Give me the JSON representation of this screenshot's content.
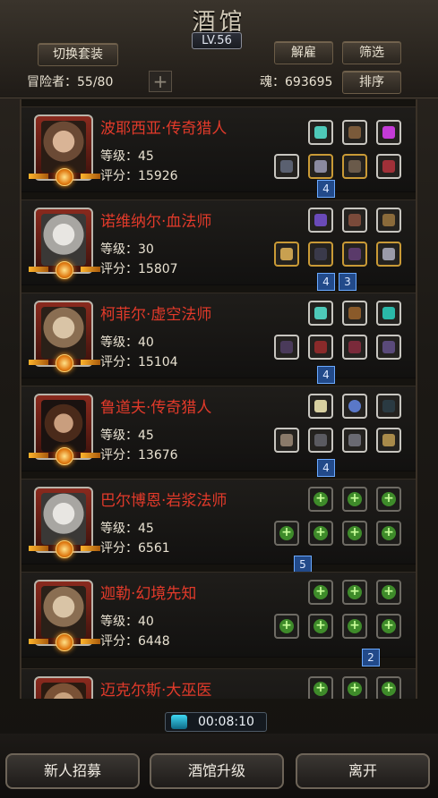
{
  "header": {
    "title": "酒馆",
    "level": "LV.56"
  },
  "toolbar": {
    "switch_outfit": "切换套装",
    "dismiss": "解雇",
    "filter": "筛选",
    "sort": "排序"
  },
  "status": {
    "adventurers": "冒险者：55/80",
    "soul": "魂：693695"
  },
  "heroes": [
    {
      "name": "波耶西亚·传奇猎人",
      "level": "等级：45",
      "score": "评分：15926",
      "badges": [
        "4"
      ]
    },
    {
      "name": "诺维纳尔·血法师",
      "level": "等级：30",
      "score": "评分：15807",
      "badges": [
        "4",
        "3"
      ]
    },
    {
      "name": "柯菲尔·虚空法师",
      "level": "等级：40",
      "score": "评分：15104",
      "badges": [
        "4"
      ]
    },
    {
      "name": "鲁道夫·传奇猎人",
      "level": "等级：45",
      "score": "评分：13676",
      "badges": [
        "4"
      ]
    },
    {
      "name": "巴尔博恩·岩浆法师",
      "level": "等级：45",
      "score": "评分：6561",
      "badges": [
        "5"
      ]
    },
    {
      "name": "迦勒·幻境先知",
      "level": "等级：40",
      "score": "评分：6448",
      "badges": [
        "2"
      ]
    },
    {
      "name": "迈克尔斯·大巫医",
      "level": "",
      "score": "",
      "badges": []
    }
  ],
  "timer": {
    "value": "00:08:10"
  },
  "bottom": {
    "recruit": "新人招募",
    "upgrade": "酒馆升级",
    "leave": "离开"
  }
}
